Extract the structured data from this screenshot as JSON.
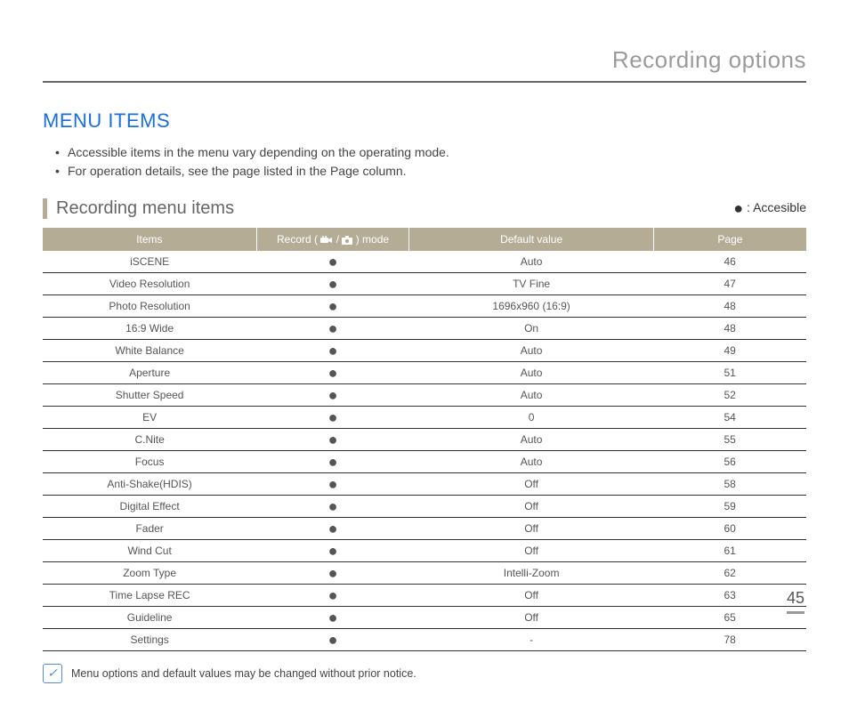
{
  "chapter_title": "Recording options",
  "section_title": "MENU ITEMS",
  "bullets": [
    "Accessible items in the menu vary depending on the operating mode.",
    "For operation details, see the page listed in the Page column."
  ],
  "subsection_title": "Recording menu items",
  "legend_label": " : Accesible",
  "table": {
    "headers": {
      "items": "Items",
      "mode_pre": "Record ( ",
      "mode_post": " ) mode",
      "default": "Default value",
      "page": "Page"
    }
  },
  "chart_data": {
    "type": "table",
    "columns": [
      "Items",
      "Record mode",
      "Default value",
      "Page"
    ],
    "rows": [
      {
        "item": "iSCENE",
        "mode": "●",
        "default": "Auto",
        "page": "46"
      },
      {
        "item": "Video Resolution",
        "mode": "●",
        "default": "TV Fine",
        "page": "47"
      },
      {
        "item": "Photo Resolution",
        "mode": "●",
        "default": "1696x960 (16:9)",
        "page": "48"
      },
      {
        "item": "16:9 Wide",
        "mode": "●",
        "default": "On",
        "page": "48"
      },
      {
        "item": "White Balance",
        "mode": "●",
        "default": "Auto",
        "page": "49"
      },
      {
        "item": "Aperture",
        "mode": "●",
        "default": "Auto",
        "page": "51"
      },
      {
        "item": "Shutter Speed",
        "mode": "●",
        "default": "Auto",
        "page": "52"
      },
      {
        "item": "EV",
        "mode": "●",
        "default": "0",
        "page": "54"
      },
      {
        "item": "C.Nite",
        "mode": "●",
        "default": "Auto",
        "page": "55"
      },
      {
        "item": "Focus",
        "mode": "●",
        "default": "Auto",
        "page": "56"
      },
      {
        "item": "Anti-Shake(HDIS)",
        "mode": "●",
        "default": "Off",
        "page": "58"
      },
      {
        "item": "Digital Effect",
        "mode": "●",
        "default": "Off",
        "page": "59"
      },
      {
        "item": "Fader",
        "mode": "●",
        "default": "Off",
        "page": "60"
      },
      {
        "item": "Wind Cut",
        "mode": "●",
        "default": "Off",
        "page": "61"
      },
      {
        "item": "Zoom Type",
        "mode": "●",
        "default": "Intelli-Zoom",
        "page": "62"
      },
      {
        "item": "Time Lapse REC",
        "mode": "●",
        "default": "Off",
        "page": "63"
      },
      {
        "item": "Guideline",
        "mode": "●",
        "default": "Off",
        "page": "65"
      },
      {
        "item": "Settings",
        "mode": "●",
        "default": "-",
        "page": "78"
      }
    ]
  },
  "note_text": "Menu options and default values may be changed without prior notice.",
  "page_number": "45"
}
